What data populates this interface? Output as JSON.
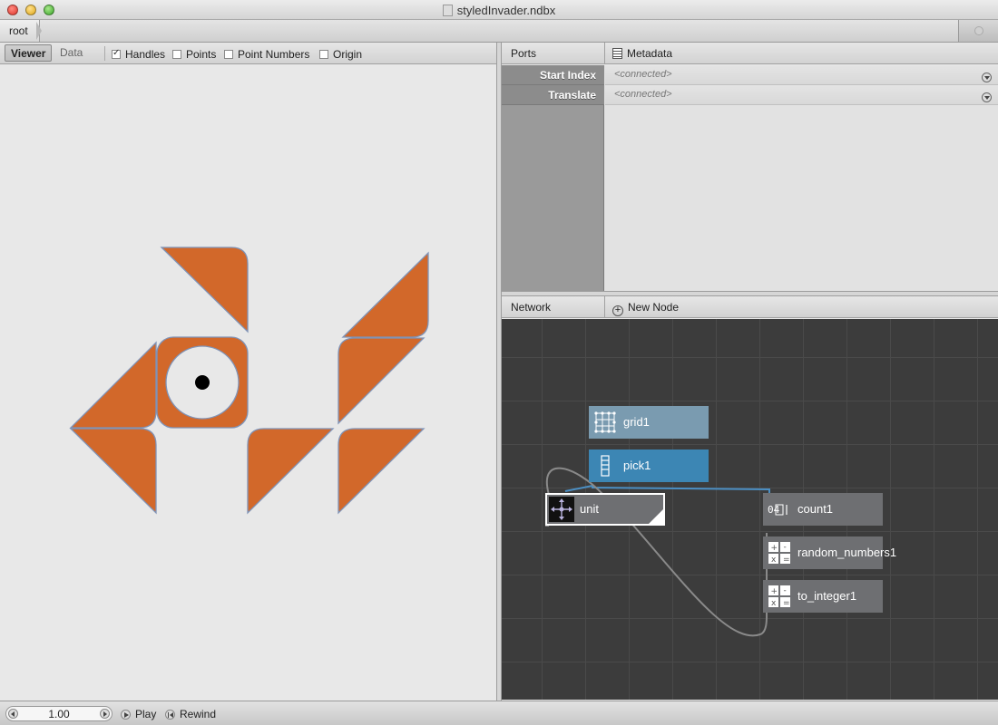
{
  "window": {
    "title": "styledInvader.ndbx"
  },
  "breadcrumb": {
    "root": "root"
  },
  "viewer": {
    "tabs": [
      {
        "label": "Viewer",
        "active": true
      },
      {
        "label": "Data",
        "active": false
      }
    ],
    "options": [
      {
        "label": "Handles",
        "checked": true
      },
      {
        "label": "Points",
        "checked": false
      },
      {
        "label": "Point Numbers",
        "checked": false
      },
      {
        "label": "Origin",
        "checked": false
      }
    ],
    "shape_color": "#d2682a",
    "shape_stroke": "#7f93b7"
  },
  "ports": {
    "header": "Ports",
    "metadata": "Metadata",
    "rows": [
      {
        "name": "Start Index",
        "value": "<connected>"
      },
      {
        "name": "Translate",
        "value": "<connected>"
      }
    ]
  },
  "network": {
    "header": "Network",
    "new_node": "New Node",
    "nodes": [
      {
        "name": "grid1",
        "icon": "grid-icon"
      },
      {
        "name": "pick1",
        "icon": "pick-icon"
      },
      {
        "name": "unit",
        "icon": "translate-icon",
        "selected": true
      },
      {
        "name": "count1",
        "icon": "count-icon"
      },
      {
        "name": "random_numbers1",
        "icon": "math-icon"
      },
      {
        "name": "to_integer1",
        "icon": "math-icon"
      }
    ],
    "colors": {
      "grid": "#7a9bb0",
      "pick": "#3c86b4",
      "default": "#6e6f72",
      "connection_blue": "#4b8fc4",
      "connection_grey": "#8a8a8a"
    }
  },
  "status": {
    "frame": "1.00",
    "play": "Play",
    "rewind": "Rewind"
  }
}
